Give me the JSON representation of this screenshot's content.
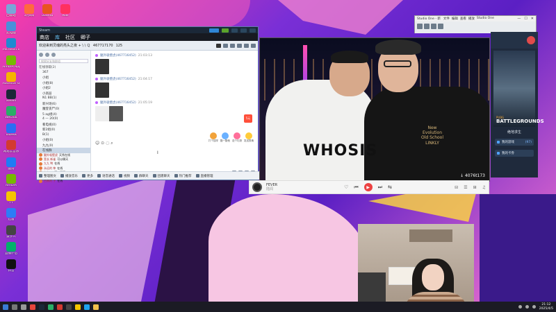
{
  "desktop": {
    "icons": [
      {
        "label": "回收站",
        "color": "#7aa7d8"
      },
      {
        "label": "此电脑",
        "color": "#4a90d9"
      },
      {
        "label": "Microsoft Edge",
        "color": "#1f8ad1"
      },
      {
        "label": "NVIDIA App",
        "color": "#76b900"
      },
      {
        "label": "Rockstar Games...",
        "color": "#f5b400"
      },
      {
        "label": "Steam",
        "color": "#1b2838"
      },
      {
        "label": "WeChat",
        "color": "#2aae67"
      },
      {
        "label": "ToDesk",
        "color": "#2a6df4"
      },
      {
        "label": "网易云音乐",
        "color": "#d33a31"
      },
      {
        "label": "酷狗",
        "color": "#1f7cf5"
      },
      {
        "label": "NVIDIA",
        "color": "#76b900"
      },
      {
        "label": "YY",
        "color": "#f4c400"
      },
      {
        "label": "迅雷",
        "color": "#2d7df6"
      },
      {
        "label": "数字人",
        "color": "#444"
      },
      {
        "label": "直播伴侣",
        "color": "#00b06b"
      },
      {
        "label": "抖音",
        "color": "#111"
      }
    ],
    "top_icons": [
      {
        "label": "3月8日",
        "color": "#ff6a3d"
      },
      {
        "label": "Ubuntu",
        "color": "#e95420"
      },
      {
        "label": "Mall",
        "color": "#ff3060"
      }
    ]
  },
  "steam": {
    "title": "Steam",
    "nav": {
      "store": "商店",
      "library": "库",
      "community": "社区",
      "user": "卿子"
    },
    "header_title": "欢迎来到灵魂的亮头之夜 + \\ \\ Ｑ",
    "header_id": "467717170",
    "header_count": "125",
    "search_placeholder": "搜索好友和群组",
    "groups": [
      "在线领取(2)",
      "367",
      "小组",
      "小组(8)",
      "小组2",
      "小高层",
      "N1 BB(1)",
      "新兴场(6)",
      "魔登丧尸(0)",
      "5 ag组(4)",
      "4 — 20(0)",
      "看电视(0)",
      "新2组(0)",
      "B(1)",
      "小组(0)",
      "九九(0)"
    ],
    "selected_group": "在线群",
    "members": [
      {
        "name": "腿外吸壁虎",
        "status": "天秀在线"
      },
      {
        "name": "宽长 新雀",
        "status": "可以聊天"
      },
      {
        "name": "九九 鸭",
        "status": "在线"
      },
      {
        "name": "永远的 坤",
        "status": "在线"
      },
      {
        "name": "九九 入",
        "status": "可以聊天"
      },
      {
        "name": "炒作 鸭",
        "status": "在线"
      },
      {
        "name": "芭蕉的 子",
        "status": "在线"
      }
    ],
    "messages": [
      {
        "sender": "腿外吸壁虎(467716452)",
        "time": "21:03:13"
      },
      {
        "sender": "腿外吸壁虎(467716452)",
        "time": "21:04:17"
      },
      {
        "sender": "腿外吸壁虎(467716452)",
        "time": "21:05:19"
      }
    ],
    "promo_badge": "5元",
    "emojis": [
      {
        "label": "打个招呼",
        "color": "#f2a33a"
      },
      {
        "label": "戳一戳他",
        "color": "#6bb1ff"
      },
      {
        "label": "送个礼物",
        "color": "#ff6f9a"
      },
      {
        "label": "发送表情",
        "color": "#ffcb3a"
      }
    ],
    "input_tools": "☺ ⊙ ◌ ⌕",
    "cursor": "I",
    "bottom_items": [
      "整理图文",
      "播放音乐",
      "更多",
      "语音通话",
      "视频",
      "群聊天",
      "团建聊天",
      "热门推荐",
      "直播管理"
    ]
  },
  "photo": {
    "shirt_text": "WHOSIS",
    "shirt_text2": "New\nEvolution\nOld School\nLINKLY",
    "watermark": "↓ 4076t173"
  },
  "music": {
    "song": "FEVER",
    "artist": "陆闻",
    "controls": {
      "like": "♡",
      "prev": "⏮",
      "play": "▶",
      "next": "⏭",
      "share": "⇆"
    },
    "right_icons": [
      "⊟",
      "☰",
      "⊞",
      "♫"
    ]
  },
  "studio": {
    "title": "Studio One - 新",
    "menu": [
      "文件",
      "编辑",
      "查看",
      "播放",
      "Studio One"
    ],
    "window_controls": [
      "—",
      "☐",
      "✕"
    ]
  },
  "pubg": {
    "mini_label": "PUBG",
    "title": "BATTLEGROUNDS",
    "game_name": "绝地求生",
    "button1": "我的游戏",
    "button1_count": "(97)",
    "button2": "我的卡券"
  },
  "taskbar": {
    "icons": [
      {
        "name": "start",
        "color": "#3a7bd5"
      },
      {
        "name": "search",
        "color": "#777"
      },
      {
        "name": "taskview",
        "color": "#999"
      },
      {
        "name": "chrome",
        "color": "#e8453c"
      },
      {
        "name": "steam",
        "color": "#1b2838"
      },
      {
        "name": "wechat",
        "color": "#2aae67"
      },
      {
        "name": "netease",
        "color": "#d33a31"
      },
      {
        "name": "obs",
        "color": "#444"
      },
      {
        "name": "yy",
        "color": "#f4c400"
      },
      {
        "name": "qq",
        "color": "#1ea3f0"
      },
      {
        "name": "explorer",
        "color": "#f2c04b"
      }
    ],
    "time": "21:12",
    "date": "2025/4/5"
  }
}
